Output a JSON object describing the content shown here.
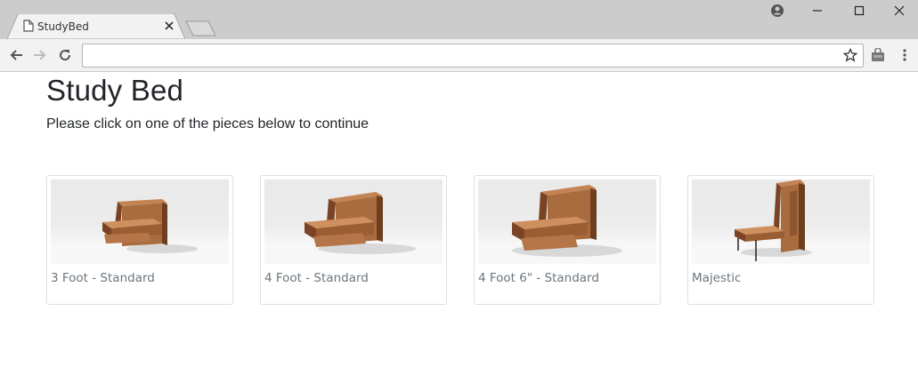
{
  "browser": {
    "tab": {
      "title": "StudyBed"
    },
    "address_bar": {
      "value": ""
    }
  },
  "page": {
    "title": "Study Bed",
    "instructions": "Please click on one of the pieces below to continue",
    "pieces": [
      {
        "label": "3 Foot - Standard",
        "icon": "study-bed-3ft-image"
      },
      {
        "label": "4 Foot - Standard",
        "icon": "study-bed-4ft-image"
      },
      {
        "label": "4 Foot 6\" - Standard",
        "icon": "study-bed-4ft6-image"
      },
      {
        "label": "Majestic",
        "icon": "study-bed-majestic-image"
      }
    ]
  },
  "colors": {
    "wood": "#a0643a",
    "wood_dark": "#6e3f1f",
    "card_border": "#dfdfdf",
    "label_text": "#6c757d"
  }
}
